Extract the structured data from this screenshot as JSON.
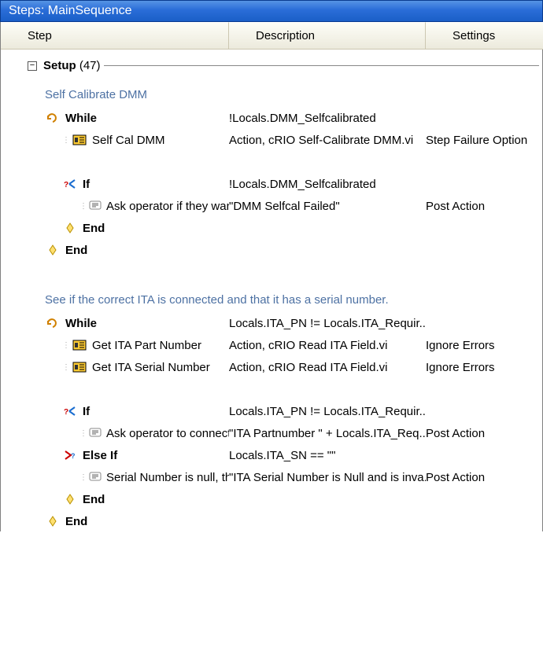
{
  "title": "Steps: MainSequence",
  "columns": {
    "step": "Step",
    "description": "Description",
    "settings": "Settings"
  },
  "section": {
    "name": "Setup",
    "count": "(47)"
  },
  "comments": {
    "selfcal": "Self Calibrate DMM",
    "ita": "See if the correct ITA is connected and that it has a serial number."
  },
  "rows": [
    {
      "name": "While",
      "desc": "!Locals.DMM_Selfcalibrated",
      "settings": "",
      "icon": "while",
      "indent": 0,
      "bold": true
    },
    {
      "name": "Self Cal DMM",
      "desc": "Action,  cRIO Self-Calibrate DMM.vi",
      "settings": "Step Failure Option",
      "icon": "action",
      "indent": 1,
      "bold": false
    },
    {
      "name": "If",
      "desc": "!Locals.DMM_Selfcalibrated",
      "settings": "",
      "icon": "if",
      "indent": 1,
      "bold": true
    },
    {
      "name": "Ask operator if they want to r...",
      "desc": "\"DMM Selfcal Failed\"",
      "settings": "Post Action",
      "icon": "msg",
      "indent": 2,
      "bold": false
    },
    {
      "name": "End",
      "desc": "",
      "settings": "",
      "icon": "end",
      "indent": 1,
      "bold": true
    },
    {
      "name": "End",
      "desc": "",
      "settings": "",
      "icon": "end",
      "indent": 0,
      "bold": true
    },
    {
      "name": "While",
      "desc": "Locals.ITA_PN != Locals.ITA_Requir...",
      "settings": "",
      "icon": "while",
      "indent": 0,
      "bold": true
    },
    {
      "name": "Get ITA Part Number",
      "desc": "Action,  cRIO Read ITA Field.vi",
      "settings": "Ignore Errors",
      "icon": "action",
      "indent": 1,
      "bold": false
    },
    {
      "name": "Get ITA Serial Number",
      "desc": "Action,  cRIO Read ITA Field.vi",
      "settings": "Ignore Errors",
      "icon": "action",
      "indent": 1,
      "bold": false
    },
    {
      "name": "If",
      "desc": "Locals.ITA_PN != Locals.ITA_Requir...",
      "settings": "",
      "icon": "if",
      "indent": 1,
      "bold": true
    },
    {
      "name": "Ask operator to connect the ...",
      "desc": "\"ITA Partnumber \" + Locals.ITA_Req...",
      "settings": "Post Action",
      "icon": "msg",
      "indent": 2,
      "bold": false
    },
    {
      "name": "Else If",
      "desc": "Locals.ITA_SN == \"\"",
      "settings": "",
      "icon": "elseif",
      "indent": 1,
      "bold": true
    },
    {
      "name": "Serial Number is null, therefo...",
      "desc": "\"ITA Serial Number is Null and is inva...",
      "settings": "Post Action",
      "icon": "msg",
      "indent": 2,
      "bold": false
    },
    {
      "name": "End",
      "desc": "",
      "settings": "",
      "icon": "end",
      "indent": 1,
      "bold": true
    },
    {
      "name": "End",
      "desc": "",
      "settings": "",
      "icon": "end",
      "indent": 0,
      "bold": true
    }
  ]
}
